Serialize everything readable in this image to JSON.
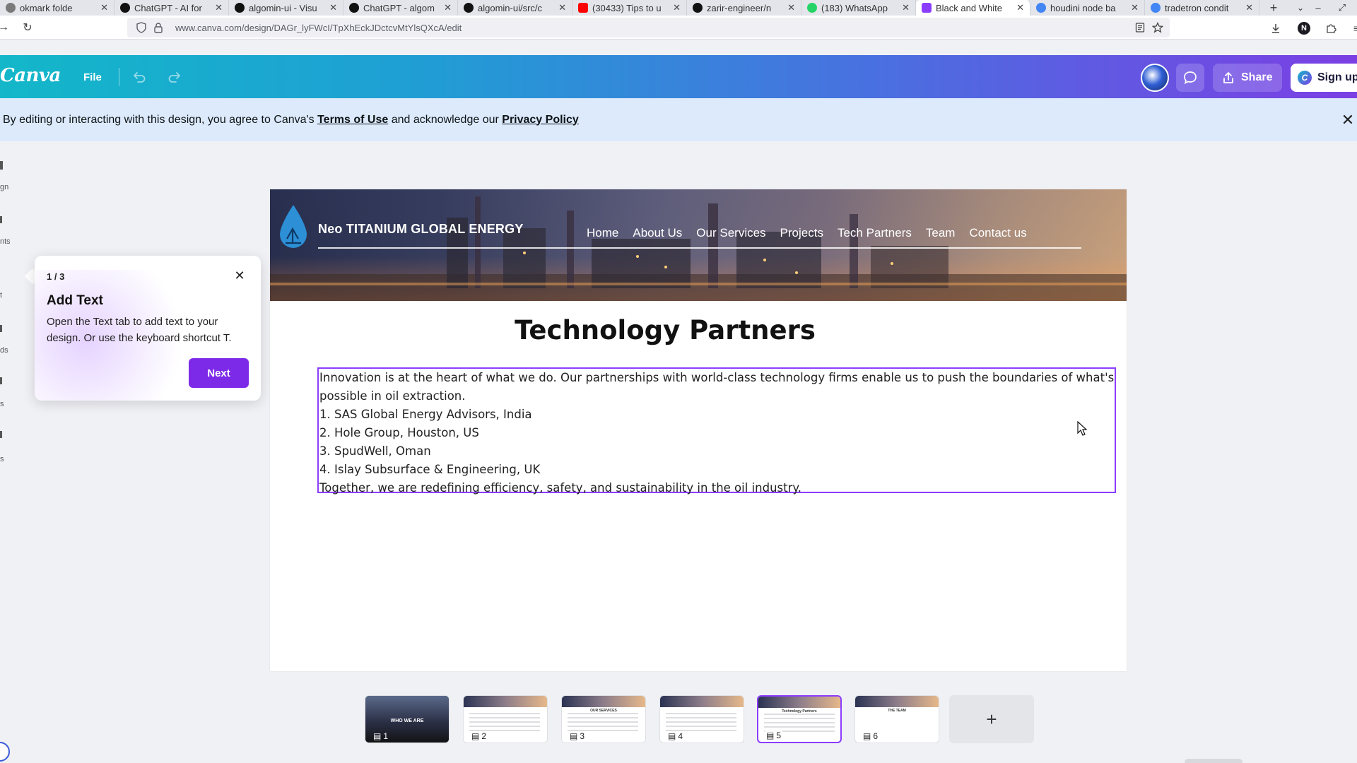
{
  "browser": {
    "tabs": [
      {
        "label": "okmark folde",
        "color": "#7a7a7a"
      },
      {
        "label": "ChatGPT - AI for",
        "color": "#111111"
      },
      {
        "label": "algomin-ui - Visu",
        "color": "#111111"
      },
      {
        "label": "ChatGPT - algom",
        "color": "#111111"
      },
      {
        "label": "algomin-ui/src/c",
        "color": "#111111"
      },
      {
        "label": "(30433) Tips to u",
        "color": "#ff0000"
      },
      {
        "label": "zarir-engineer/n",
        "color": "#111111"
      },
      {
        "label": "(183) WhatsApp",
        "color": "#25d366"
      },
      {
        "label": "Black and White",
        "color": "#8b3dff"
      },
      {
        "label": "houdini node ba",
        "color": "#4285f4"
      },
      {
        "label": "tradetron condit",
        "color": "#4285f4"
      }
    ],
    "active_tab_index": 8,
    "tab_close_glyph": "✕",
    "new_tab_glyph": "+",
    "url": "www.canva.com/design/DAGr_lyFWcI/TpXhEckJDctcvMtYlsQXcA/edit",
    "profile_initial": "N"
  },
  "canva_header": {
    "logo": "Canva",
    "file_label": "File",
    "share_label": "Share",
    "signup_label": "Sign up"
  },
  "notice": {
    "prefix": "By editing or interacting with this design, you agree to Canva's ",
    "terms_link": "Terms of Use",
    "middle": " and acknowledge our ",
    "privacy_link": "Privacy Policy",
    "close_glyph": "✕"
  },
  "side_rail": {
    "fragments": [
      "gn",
      "nts",
      "t",
      "ds",
      "s",
      "s"
    ]
  },
  "design": {
    "company_name": "Neo TITANIUM GLOBAL ENERGY",
    "nav": [
      "Home",
      "About Us",
      "Our Services",
      "Projects",
      "Tech Partners",
      "Team",
      "Contact us"
    ],
    "title": "Technology Partners",
    "body": [
      "Innovation is at the heart of what we do. Our partnerships with world-class technology firms enable us to push the boundaries of what's possible in oil extraction.",
      "1. SAS Global Energy Advisors, India",
      "2. Hole Group, Houston, US",
      "3. SpudWell, Oman",
      "4. Islay Subsurface & Engineering, UK",
      "Together, we are redefining efficiency, safety, and sustainability in the oil industry."
    ]
  },
  "tooltip": {
    "step": "1 / 3",
    "title": "Add Text",
    "body": "Open the Text tab to add text to your design. Or use the keyboard shortcut T.",
    "next_label": "Next",
    "close_glyph": "✕"
  },
  "pages": {
    "thumbnails": [
      {
        "number": "1",
        "caption": "WHO WE ARE"
      },
      {
        "number": "2",
        "caption": ""
      },
      {
        "number": "3",
        "caption": "OUR SERVICES"
      },
      {
        "number": "4",
        "caption": ""
      },
      {
        "number": "5",
        "caption": "Technology Partners"
      },
      {
        "number": "6",
        "caption": "THE TEAM"
      }
    ],
    "selected_index": 4,
    "add_label": "+"
  },
  "colors": {
    "accent": "#8b3dff",
    "next_button": "#7d2ae8",
    "notice_bg": "#dceafb"
  }
}
